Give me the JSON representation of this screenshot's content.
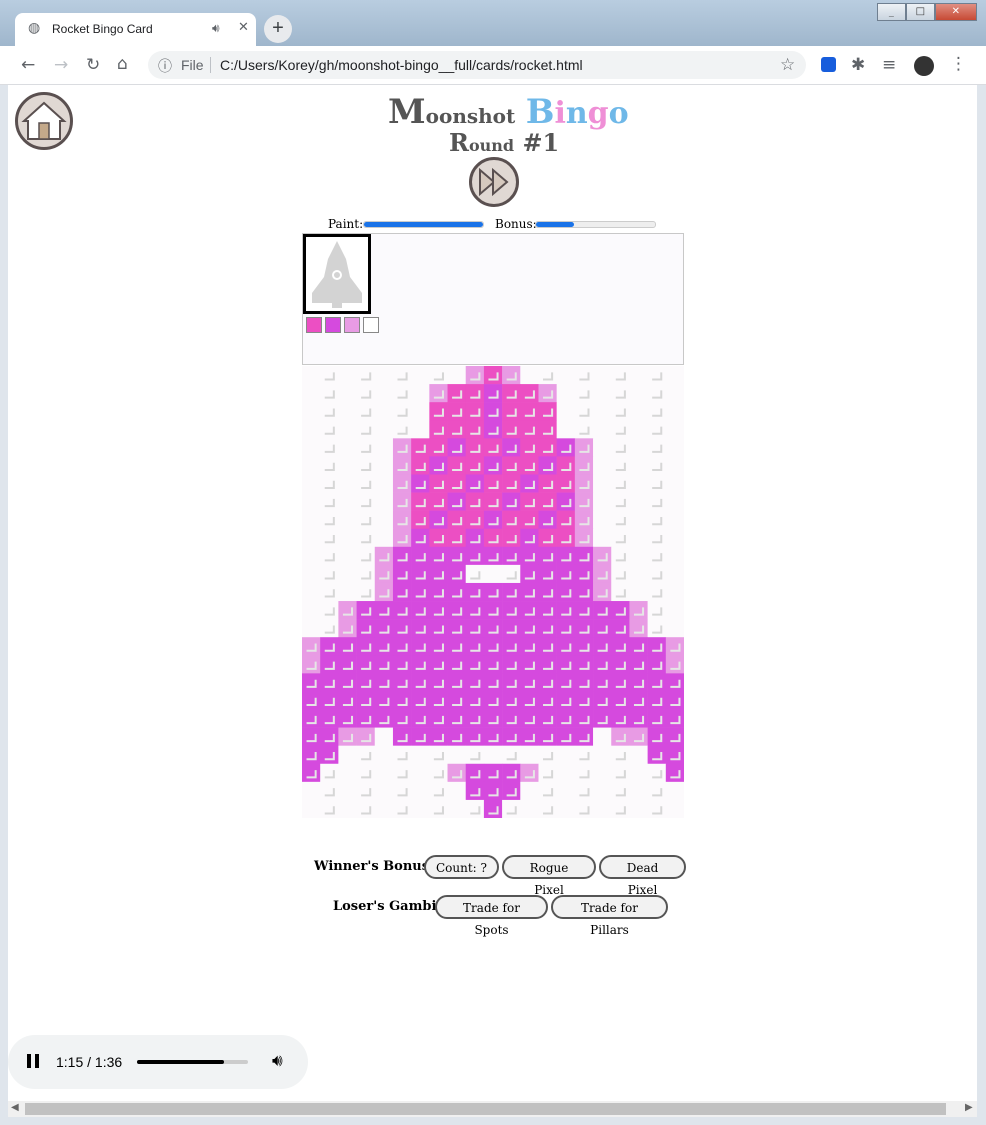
{
  "browser": {
    "tab_title": "Rocket Bingo Card",
    "new_tab": "+",
    "file_label": "File",
    "url": "C:/Users/Korey/gh/moonshot-bingo__full/cards/rocket.html"
  },
  "header": {
    "brand_m": "M",
    "brand_oonshot": "oonshot",
    "brand_b": "B",
    "brand_i": "i",
    "brand_n": "n",
    "brand_g": "g",
    "brand_o": "o",
    "round_r": "R",
    "round_ound": "ound",
    "round_num": "#1"
  },
  "meters": {
    "paint_label": "Paint:",
    "paint_fraction": 1.0,
    "bonus_label": "Bonus:",
    "bonus_fraction": 0.32
  },
  "palette": [
    "#ec4fc3",
    "#d54ade",
    "#e89be4",
    "#ffffff"
  ],
  "buttons": {
    "winners_label": "Winner's Bonus:",
    "count": "Count: ?",
    "rogue": "Rogue Pixel",
    "dead": "Dead Pixel",
    "losers_label": "Loser's Gambit",
    "losers_colon": ":",
    "spots": "Trade for Spots",
    "pillars": "Trade for Pillars"
  },
  "audio": {
    "time": "1:15 / 1:36",
    "progress_fraction": 0.78
  },
  "colors": {
    "pink": "#ec4fc3",
    "purple": "#d54ade",
    "light": "#e89be4",
    "brand_gray": "#555555",
    "bingo_blue": "#6fb8e8",
    "bingo_pink": "#ef8fd6"
  },
  "icons": {
    "home": "home-icon",
    "fast_forward": "fast-forward-icon",
    "play_pause": "pause-icon",
    "volume": "volume-icon"
  }
}
